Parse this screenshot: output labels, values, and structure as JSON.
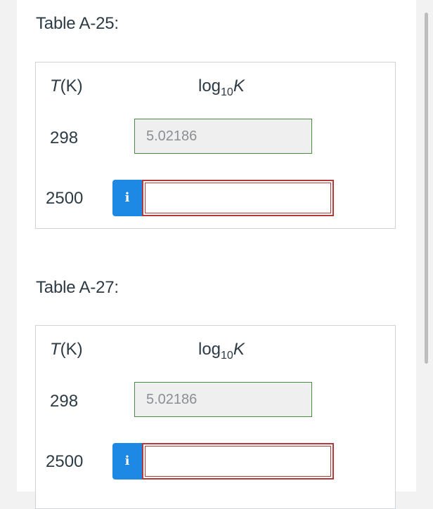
{
  "tables": [
    {
      "heading": "Table A-25:",
      "col_t_label": "T",
      "col_t_unit": "(K)",
      "col_log_prefix": "log",
      "col_log_sub": "10",
      "col_log_var": "K",
      "row1": {
        "temp": "298",
        "value": "5.02186"
      },
      "row2": {
        "temp": "2500",
        "info_icon": "i",
        "answer_value": ""
      }
    },
    {
      "heading": "Table A-27:",
      "col_t_label": "T",
      "col_t_unit": "(K)",
      "col_log_prefix": "log",
      "col_log_sub": "10",
      "col_log_var": "K",
      "row1": {
        "temp": "298",
        "value": "5.02186"
      },
      "row2": {
        "temp": "2500",
        "info_icon": "i",
        "answer_value": ""
      }
    }
  ],
  "colors": {
    "info_button": "#1e88e5",
    "answer_border": "#b33a3a",
    "given_border": "#4a8a44"
  }
}
